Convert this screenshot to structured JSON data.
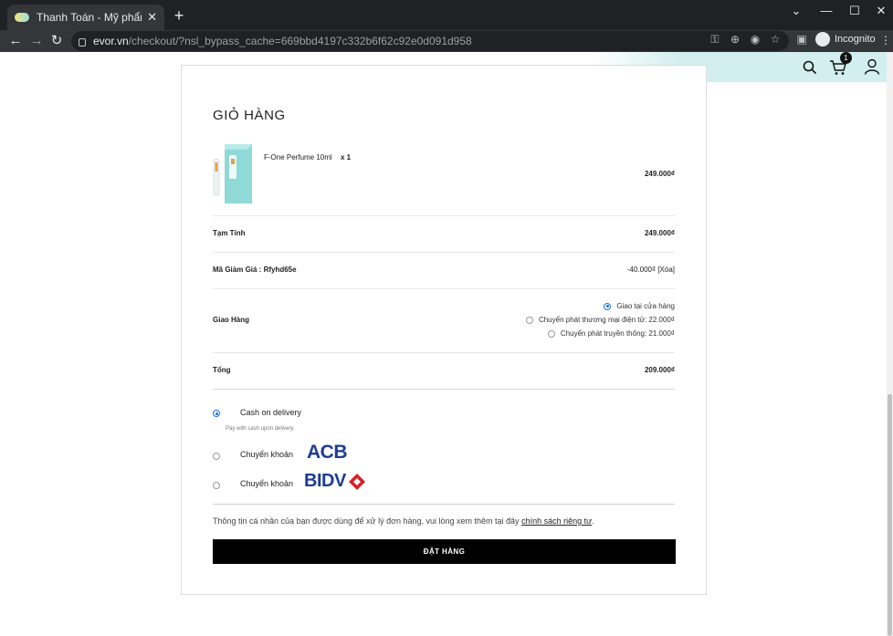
{
  "browser": {
    "tab_title": "Thanh Toán - Mỹ phẩm, nước hoa",
    "tab_close": "✕",
    "new_tab": "+",
    "url_host": "evor.vn",
    "url_path": "/checkout/?nsl_bypass_cache=669bbd4197c332b6f62c92e0d091d958",
    "profile_label": "Incognito"
  },
  "header": {
    "cart_count": "1"
  },
  "cart": {
    "title": "GIỎ HÀNG",
    "product": {
      "name": "F-One Perfume 10ml",
      "qty": "x 1",
      "price": "249.000₫"
    },
    "subtotal": {
      "label": "Tạm Tính",
      "value": "249.000₫"
    },
    "coupon": {
      "label": "Mã Giảm Giá : Rfyhd65e",
      "value": "-40.000₫ [Xóa]"
    },
    "shipping": {
      "label": "Giao Hàng",
      "options": [
        {
          "label": "Giao tại cửa hàng",
          "selected": true
        },
        {
          "label": "Chuyển phát thương mại điện tử: 22.000₫",
          "selected": false
        },
        {
          "label": "Chuyển phát truyền thống: 21.000₫",
          "selected": false
        }
      ]
    },
    "total": {
      "label": "Tổng",
      "value": "209.000₫"
    }
  },
  "payment": {
    "cod": {
      "label": "Cash on delivery",
      "desc": "Pay with cash upon delivery.",
      "selected": true
    },
    "acb": {
      "label": "Chuyển khoản",
      "logo_text": "ACB",
      "selected": false
    },
    "bidv": {
      "label": "Chuyển khoản",
      "logo_text": "BIDV",
      "selected": false
    }
  },
  "privacy": {
    "text": "Thông tin cá nhân của bạn được dùng để xử lý đơn hàng, vui lòng xem thêm tại đây ",
    "link": "chính sách riêng tư",
    "end": "."
  },
  "order_button": "ĐẶT HÀNG",
  "colors": {
    "accent": "#1a73e8",
    "header_tint": "#d2eeee",
    "bank_blue": "#1f3c93",
    "bidv_red": "#d71f26"
  }
}
